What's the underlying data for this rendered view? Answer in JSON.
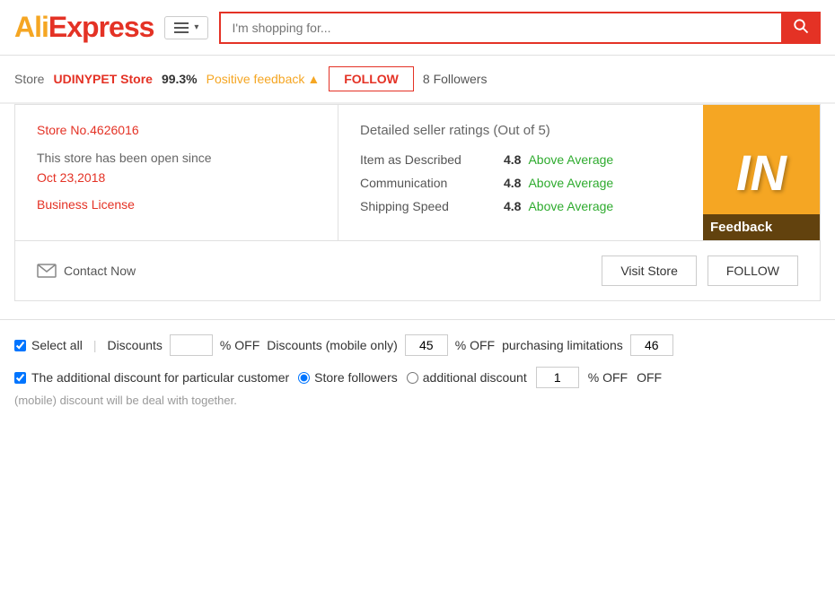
{
  "header": {
    "logo_text": "AliExpress",
    "search_placeholder": "I'm shopping for...",
    "menu_label": "Menu"
  },
  "store_nav": {
    "store_label": "Store",
    "store_name": "UDINYPET Store",
    "feedback_pct": "99.3%",
    "feedback_label": "Positive feedback",
    "follow_btn": "FOLLOW",
    "followers": "8 Followers"
  },
  "store_info": {
    "store_number": "Store No.4626016",
    "since_text": "This store has been open since",
    "since_date": "Oct 23,2018",
    "business_license": "Business License",
    "ratings_title": "Detailed seller ratings",
    "ratings_subtitle": "(Out of 5)",
    "ratings": [
      {
        "label": "Item as Described",
        "value": "4.8",
        "status": "Above Average"
      },
      {
        "label": "Communication",
        "value": "4.8",
        "status": "Above Average"
      },
      {
        "label": "Shipping Speed",
        "value": "4.8",
        "status": "Above Average"
      }
    ],
    "banner_letters": "IN",
    "feedback_overlay": "Feedback"
  },
  "actions": {
    "contact_btn": "Contact Now",
    "visit_store_btn": "Visit Store",
    "follow_btn": "FOLLOW"
  },
  "discounts": {
    "select_all_label": "Select all",
    "discounts_label": "Discounts",
    "discounts_value": "",
    "off_label": "% OFF",
    "mobile_label": "Discounts (mobile only)",
    "mobile_value": "45",
    "mobile_off": "% OFF",
    "limitations_label": "purchasing limitations",
    "limitations_value": "46",
    "additional_label": "The additional discount for particular customer",
    "store_followers_label": "Store followers",
    "additional_discount_label": "additional discount",
    "additional_discount_value": "1",
    "additional_off": "% OFF",
    "additional_off2": "OFF",
    "note": "(mobile) discount will be deal with together."
  }
}
